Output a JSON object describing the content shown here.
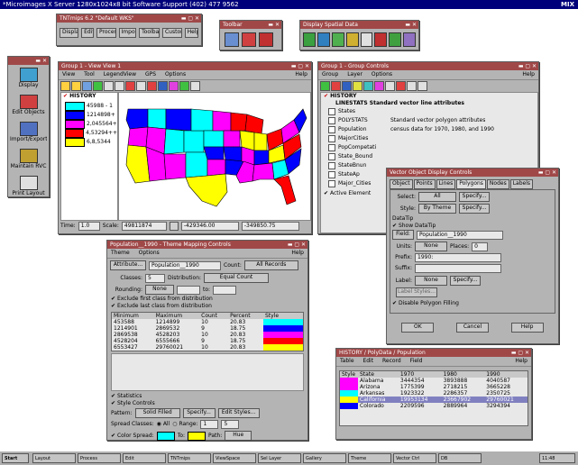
{
  "desktop": {
    "title": "*Microimages X Server 1280x1024x8 bit Software Support (402) 477 9562",
    "logo": "MIX"
  },
  "tntmips": {
    "title": "TNTmips 6.2 \"Default WKS\"",
    "menu": [
      "Display",
      "Edit",
      "Process",
      "Import",
      "Toolbars",
      "Custom",
      "Help"
    ]
  },
  "edit_toolbar": {
    "title": "Toolbar"
  },
  "spatial_toolbar": {
    "title": "Display Spatial Data"
  },
  "left_toolbar": {
    "items": [
      "Display",
      "Edit Objects",
      "Import/Export",
      "Maintain RVC",
      "Print Layout"
    ]
  },
  "view_window": {
    "title": "Group 1 - View View 1",
    "menu": [
      "View",
      "Tool",
      "LegendView",
      "GPS",
      "Options"
    ],
    "help": "Help",
    "legend_title": "HISTORY",
    "legend": [
      {
        "label": "45988 - 1",
        "color": "#00ffff"
      },
      {
        "label": "1214898+",
        "color": "#0000ff"
      },
      {
        "label": "2,045564+",
        "color": "#ff00ff"
      },
      {
        "label": "4,53294++",
        "color": "#ff0000"
      },
      {
        "label": "6,8,5344",
        "color": "#ffff00"
      }
    ],
    "status": {
      "time_label": "Time:",
      "time": "1.0",
      "scale_label": "Scale:",
      "scale": "49811874",
      "x": "-429346.00",
      "y": "-349850.75"
    }
  },
  "group_controls": {
    "title": "Group 1 - Group Controls",
    "menu": [
      "Group",
      "Layer",
      "Options"
    ],
    "help": "Help",
    "history_label": "HISTORY",
    "header_text": "LINESTATS Standard vector line attributes",
    "layers": [
      {
        "name": "States",
        "desc": ""
      },
      {
        "name": "POLYSTATS",
        "desc": "Standard vector polygon attributes"
      },
      {
        "name": "Population",
        "desc": "census data for 1970, 1980, and 1990"
      },
      {
        "name": "MajorCities",
        "desc": ""
      },
      {
        "name": "PopCompetati",
        "desc": ""
      },
      {
        "name": "State_Bound",
        "desc": ""
      },
      {
        "name": "StateBnun",
        "desc": ""
      },
      {
        "name": "StateAp",
        "desc": ""
      },
      {
        "name": "Major_Cities",
        "desc": ""
      }
    ],
    "active_element": "Active Element"
  },
  "theme_window": {
    "title": "Population__1990 - Theme Mapping Controls",
    "menu": [
      "Theme",
      "Options"
    ],
    "help": "Help",
    "attribute_button": "Attribute...",
    "attribute_value": "Population__1990",
    "count_label": "Count:",
    "count_value": "All Records",
    "classes_label": "Classes:",
    "classes_value": "5",
    "distribution_label": "Distribution:",
    "distribution_value": "Equal Count",
    "rounding_label": "Rounding:",
    "rounding_value": "None",
    "to_label": "to:",
    "exclude_first": "Exclude first class from distribution",
    "exclude_last": "Exclude last class from distribution",
    "headers": [
      "Minimum",
      "Maximum",
      "Count",
      "Percent",
      "Style"
    ],
    "rows": [
      {
        "min": "453588",
        "max": "1214899",
        "count": "10",
        "pct": "20.83",
        "color": "#00ffff"
      },
      {
        "min": "1214901",
        "max": "2869532",
        "count": "9",
        "pct": "18.75",
        "color": "#0000ff"
      },
      {
        "min": "2869538",
        "max": "4528203",
        "count": "10",
        "pct": "20.83",
        "color": "#ff00ff"
      },
      {
        "min": "4528204",
        "max": "6555666",
        "count": "9",
        "pct": "18.75",
        "color": "#ff0000"
      },
      {
        "min": "6553427",
        "max": "29760021",
        "count": "10",
        "pct": "20.83",
        "color": "#ffff00"
      }
    ],
    "statistics": "Statistics",
    "style_controls": "Style Controls",
    "pattern_label": "Pattern:",
    "pattern_value": "Solid Filled",
    "specify_button": "Specify...",
    "edit_styles_button": "Edit Styles...",
    "spread_label": "Spread Classes:",
    "spread_all": "All",
    "spread_range": "Range:",
    "range_from": "1",
    "range_to": "5",
    "color_spread": "Color Spread:",
    "from_label": "To:",
    "path_label": "Path:",
    "path_value": "Hue"
  },
  "vector_controls": {
    "title": "Vector Object Display Controls",
    "tabs": [
      "Object",
      "Points",
      "Lines",
      "Polygons",
      "Nodes",
      "Labels"
    ],
    "select_label": "Select:",
    "select_value": "All",
    "specify": "Specify...",
    "style_label": "Style:",
    "style_value": "By Theme",
    "datatip_label": "DataTip",
    "show_datatip": "Show DataTip",
    "field_button": "Field:",
    "field_value": "Population__1990",
    "units_label": "Units:",
    "units_value": "None",
    "places_label": "Places:",
    "places_value": "0",
    "prefix_label": "Prefix:",
    "prefix_value": "1990:",
    "suffix_label": "Suffix:",
    "label_label": "Label:",
    "label_value": "None",
    "label_specify": "Specify...",
    "label_styles": "Label Styles...",
    "disable_fill": "Disable Polygon Filling",
    "ok": "OK",
    "cancel": "Cancel",
    "help": "Help"
  },
  "db_window": {
    "title": "HISTORY / PolyData / Population",
    "menu": [
      "Table",
      "Edit",
      "Record",
      "Field"
    ],
    "help": "Help",
    "headers": [
      "Style",
      "State",
      "1970",
      "1980",
      "1990"
    ],
    "rows": [
      {
        "state": "Alabama",
        "c1": "3444354",
        "c2": "3893888",
        "c3": "4040587",
        "color": "#ff00ff"
      },
      {
        "state": "Arizona",
        "c1": "1775399",
        "c2": "2718215",
        "c3": "3665228",
        "color": "#ff00ff"
      },
      {
        "state": "Arkansas",
        "c1": "1923322",
        "c2": "2286357",
        "c3": "2350725",
        "color": "#00ffff"
      },
      {
        "state": "California",
        "c1": "19953134",
        "c2": "23667902",
        "c3": "29760021",
        "color": "#ffff00"
      },
      {
        "state": "Colorado",
        "c1": "2209596",
        "c2": "2889964",
        "c3": "3294394",
        "color": "#0000ff"
      }
    ]
  },
  "taskbar": {
    "start": "Start",
    "items": [
      "Layout",
      "Process",
      "Edit",
      "TNTmips",
      "ViewSpace",
      "Sel Layer",
      "Gallery",
      "Theme",
      "Vector Ctrl",
      "DB"
    ],
    "tray": "11:48"
  }
}
